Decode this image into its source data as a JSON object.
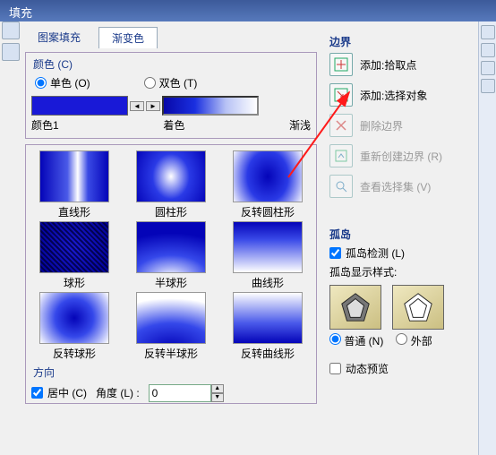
{
  "window": {
    "title": "填充"
  },
  "tabs": {
    "pattern": "图案填充",
    "gradient": "渐变色"
  },
  "color_group": {
    "legend": "颜色 (C)",
    "single": "单色 (O)",
    "double": "双色 (T)",
    "label_color1": "颜色1",
    "label_tint": "着色",
    "label_light": "渐浅"
  },
  "gradients": [
    [
      "直线形",
      "圆柱形",
      "反转圆柱形"
    ],
    [
      "球形",
      "半球形",
      "曲线形"
    ],
    [
      "反转球形",
      "反转半球形",
      "反转曲线形"
    ]
  ],
  "direction": {
    "legend": "方向",
    "center": "居中 (C)",
    "angle_label": "角度 (L) :",
    "angle_value": "0"
  },
  "boundary": {
    "legend": "边界",
    "items": [
      {
        "label": "添加:拾取点",
        "enabled": true
      },
      {
        "label": "添加:选择对象",
        "enabled": true
      },
      {
        "label": "删除边界",
        "enabled": false
      },
      {
        "label": "重新创建边界 (R)",
        "enabled": false
      },
      {
        "label": "查看选择集 (V)",
        "enabled": false
      }
    ]
  },
  "island": {
    "legend": "孤岛",
    "detect": "孤岛检测 (L)",
    "style": "孤岛显示样式:",
    "normal": "普通 (N)",
    "outer": "外部"
  },
  "preview": {
    "dynamic": "动态预览"
  }
}
